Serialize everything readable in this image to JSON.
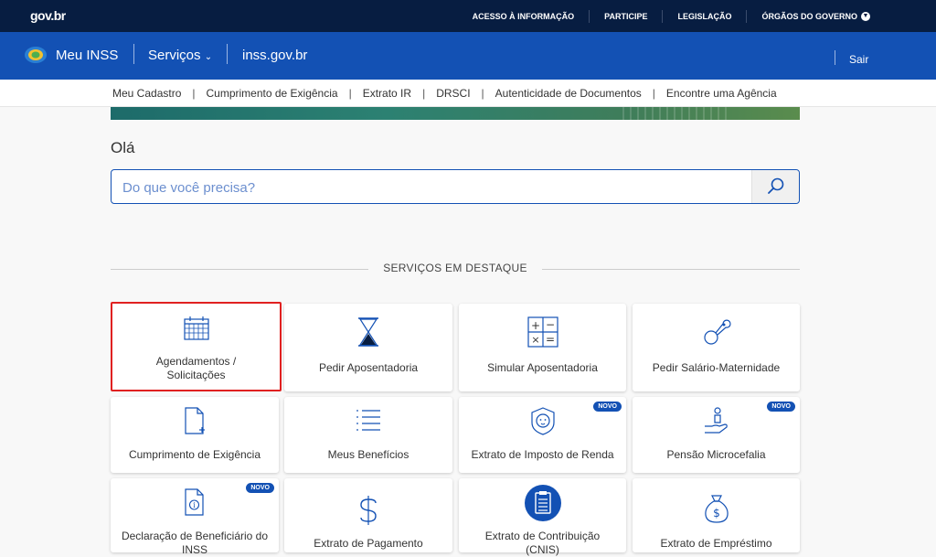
{
  "govbar": {
    "logo": "gov.br",
    "links": [
      "ACESSO À INFORMAÇÃO",
      "PARTICIPE",
      "LEGISLAÇÃO",
      "ÓRGÃOS DO GOVERNO"
    ]
  },
  "header": {
    "title": "Meu INSS",
    "services_label": "Serviços",
    "site": "inss.gov.br",
    "logout": "Sair"
  },
  "subnav": [
    "Meu Cadastro",
    "Cumprimento de Exigência",
    "Extrato IR",
    "DRSCI",
    "Autenticidade de Documentos",
    "Encontre uma Agência"
  ],
  "greeting": "Olá",
  "search": {
    "placeholder": "Do que você precisa?"
  },
  "section_title": "SERVIÇOS EM DESTAQUE",
  "badge_text": "NOVO",
  "cards": [
    {
      "label": "Agendamentos / Solicitações",
      "icon": "calendar-icon"
    },
    {
      "label": "Pedir Aposentadoria",
      "icon": "hourglass-icon"
    },
    {
      "label": "Simular Aposentadoria",
      "icon": "calculator-icon"
    },
    {
      "label": "Pedir Salário-Maternidade",
      "icon": "pacifier-icon"
    },
    {
      "label": "Cumprimento de Exigência",
      "icon": "document-add-icon"
    },
    {
      "label": "Meus Benefícios",
      "icon": "list-icon"
    },
    {
      "label": "Extrato de Imposto de Renda",
      "icon": "lion-icon"
    },
    {
      "label": "Pensão Microcefalia",
      "icon": "hand-person-icon"
    },
    {
      "label": "Declaração de Beneficiário do INSS",
      "icon": "document-info-icon"
    },
    {
      "label": "Extrato de Pagamento",
      "icon": "dollar-icon"
    },
    {
      "label": "Extrato de Contribuição (CNIS)",
      "icon": "clipboard-icon"
    },
    {
      "label": "Extrato de Empréstimo",
      "icon": "money-bag-icon"
    }
  ]
}
